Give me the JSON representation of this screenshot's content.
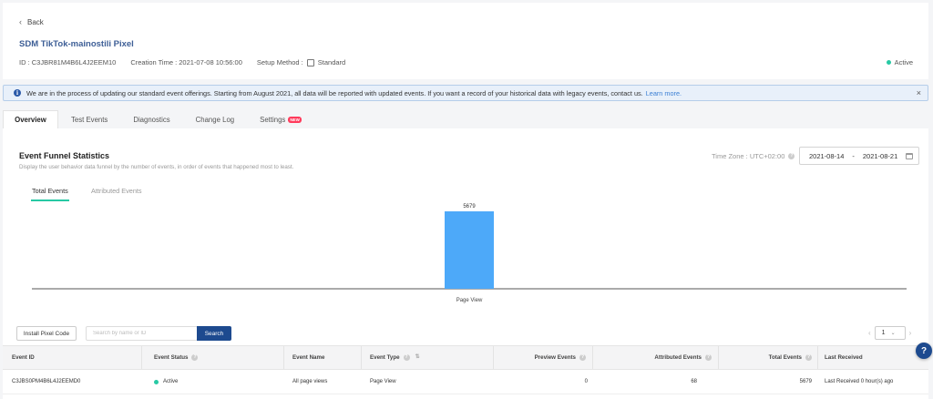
{
  "header": {
    "back_label": "Back",
    "pixel_name": "SDM TikTok-mainostili Pixel",
    "id_text": "ID : C3JBR81M4B6L4J2EEM10",
    "creation_time": "Creation Time : 2021-07-08 10:56:00",
    "setup_method_label": "Setup Method :",
    "setup_method_value": "Standard",
    "status": "Active"
  },
  "banner": {
    "message": "We are in the process of updating our standard event offerings. Starting from August 2021, all data will be reported with updated events. If you want a record of your historical data with legacy events, contact us.",
    "link": "Learn more.",
    "close": "×"
  },
  "tabs": [
    {
      "label": "Overview"
    },
    {
      "label": "Test Events"
    },
    {
      "label": "Diagnostics"
    },
    {
      "label": "Change Log"
    },
    {
      "label": "Settings",
      "badge": "NEW"
    }
  ],
  "funnel": {
    "title": "Event Funnel Statistics",
    "description": "Display the user behavior data funnel by the number of events, in order of events that happened most to least.",
    "timezone": "Time Zone : UTC+02:00",
    "date_start": "2021-08-14",
    "date_sep": "-",
    "date_end": "2021-08-21",
    "subtabs": [
      "Total Events",
      "Attributed Events"
    ]
  },
  "chart_data": {
    "type": "bar",
    "categories": [
      "Page View"
    ],
    "values": [
      5679
    ],
    "title": "",
    "xlabel": "",
    "ylabel": "",
    "color": "#4da9f9",
    "grid": false
  },
  "toolbar": {
    "install_label": "Install Pixel Code",
    "search_placeholder": "Search by name or ID",
    "search_button": "Search",
    "page": "1",
    "prev": "‹",
    "next": "›"
  },
  "table": {
    "headers": [
      "Event ID",
      "Event Status",
      "Event Name",
      "Event Type",
      "Preview Events",
      "Attributed Events",
      "Total Events",
      "Last Received"
    ],
    "rows": [
      [
        "C3JBS0PM4B6L4J2EEMD0",
        "Active",
        "All page views",
        "Page View",
        "0",
        "68",
        "5679",
        "Last Received 0 hour(s) ago"
      ]
    ]
  },
  "colors": {
    "accent": "#1d4a8f",
    "active_dot": "#27c9a4",
    "bar": "#4da9f9",
    "badge": "#ff3b5c"
  },
  "help": "?"
}
